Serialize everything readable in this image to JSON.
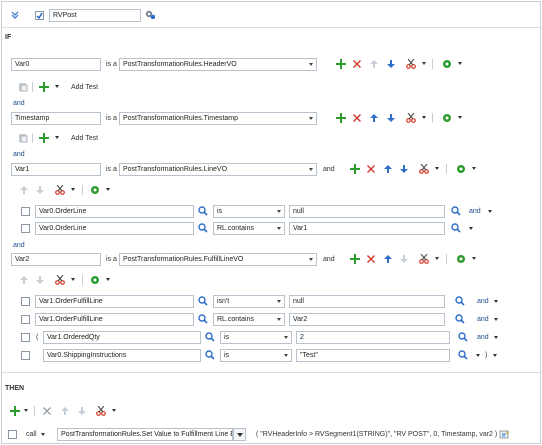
{
  "header": {
    "rule_name": "RVPost"
  },
  "sections": {
    "if_label": "IF",
    "then_label": "THEN"
  },
  "conditions": {
    "row1": {
      "var": "Var0",
      "is_a": "is a",
      "type": "PostTransformationRules.HeaderVO"
    },
    "and1": "and",
    "add_test_1": "Add Test",
    "row2": {
      "var": "Timestamp",
      "is_a": "is a",
      "type": "PostTransformationRules.Timestamp"
    },
    "add_test_2": "Add Test",
    "and2": "and",
    "row3": {
      "var": "Var1",
      "is_a": "is a",
      "type": "PostTransformationRules.LineVO",
      "join": "and"
    },
    "tests3": [
      {
        "left": "Var0.OrderLine",
        "op": "is",
        "right": "null",
        "join": "and"
      },
      {
        "left": "Var0.OrderLine",
        "op": "RL.contains",
        "right": "Var1",
        "join": ""
      }
    ],
    "and3": "and",
    "row4": {
      "var": "Var2",
      "is_a": "is a",
      "type": "PostTransformationRules.FulfillLineVO",
      "join": "and"
    },
    "tests4": [
      {
        "paren": "",
        "left": "Var1.OrderFulfillLine",
        "op": "isn't",
        "right": "null",
        "join": "and"
      },
      {
        "paren": "",
        "left": "Var1.OrderFulfillLine",
        "op": "RL.contains",
        "right": "Var2",
        "join": "and"
      },
      {
        "paren": "(",
        "left": "Var1.OrderedQty",
        "op": "is",
        "right": "2",
        "join": "and"
      },
      {
        "paren": "",
        "left": "Var0.ShippingInstructions",
        "op": "is",
        "right": "\"Test\"",
        "join": "",
        "close_paren": ")"
      }
    ]
  },
  "action": {
    "kind": "call",
    "function": "PostTransformationRules.Set Value to Fulfillment Line E",
    "args": "( \"RVHeaderInfo > RVSegment1(STRING)\", \"RV POST\", 0, Timestamp, var2 )"
  },
  "colors": {
    "add_green": "#2e9b2e",
    "delete_red": "#d23b2b",
    "move_blue": "#2f6fc9",
    "border": "#b8c2cc",
    "link": "#1f4e8c"
  }
}
